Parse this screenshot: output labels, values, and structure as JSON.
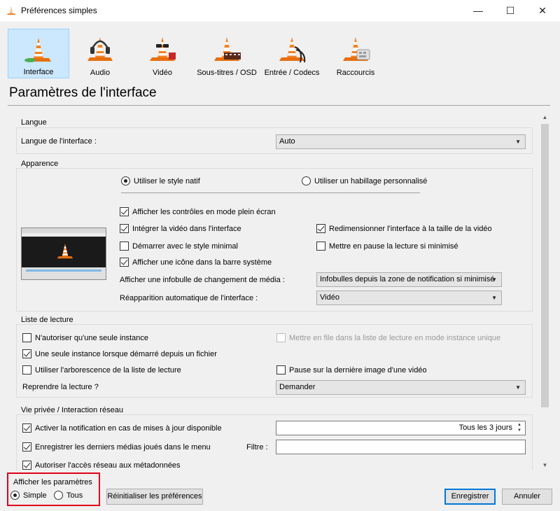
{
  "window": {
    "title": "Préférences simples",
    "minimize": "—",
    "maximize": "☐",
    "close": "✕"
  },
  "categories": [
    {
      "label": "Interface",
      "selected": true
    },
    {
      "label": "Audio",
      "selected": false
    },
    {
      "label": "Vidéo",
      "selected": false
    },
    {
      "label": "Sous-titres / OSD",
      "selected": false
    },
    {
      "label": "Entrée / Codecs",
      "selected": false
    },
    {
      "label": "Raccourcis",
      "selected": false
    }
  ],
  "page_title": "Paramètres de l'interface",
  "langue": {
    "group_title": "Langue",
    "label": "Langue de l'interface :",
    "value": "Auto"
  },
  "apparence": {
    "group_title": "Apparence",
    "style_native": "Utiliser le style natif",
    "style_custom": "Utiliser un habillage personnalisé",
    "style_selected": "native",
    "fullscreen_controls": {
      "label": "Afficher les contrôles en mode plein écran",
      "checked": true
    },
    "embed_video": {
      "label": "Intégrer la vidéo dans l'interface",
      "checked": true
    },
    "resize_interface": {
      "label": "Redimensionner l'interface à la taille de la vidéo",
      "checked": true
    },
    "minimal_style": {
      "label": "Démarrer avec le style minimal",
      "checked": false
    },
    "pause_minimized": {
      "label": "Mettre en pause la lecture si minimisé",
      "checked": false
    },
    "systray_icon": {
      "label": "Afficher une icône dans la barre système",
      "checked": true
    },
    "popup_label": "Afficher une infobulle de changement de média :",
    "popup_value": "Infobulles depuis la zone de notification si minimisé",
    "autoraise_label": "Réapparition automatique de l'interface :",
    "autoraise_value": "Vidéo"
  },
  "playlist": {
    "group_title": "Liste de lecture",
    "one_instance": {
      "label": "N'autoriser qu'une seule instance",
      "checked": false
    },
    "enqueue": {
      "label": "Mettre en file dans la liste de lecture en mode instance unique",
      "checked": false,
      "disabled": true
    },
    "one_instance_file": {
      "label": "Une seule instance lorsque démarré depuis un fichier",
      "checked": true
    },
    "tree": {
      "label": "Utiliser l'arborescence de la liste de lecture",
      "checked": false
    },
    "pause_last": {
      "label": "Pause sur la dernière image d'une vidéo",
      "checked": false
    },
    "resume_label": "Reprendre la lecture ?",
    "resume_value": "Demander"
  },
  "privacy": {
    "group_title": "Vie privée / Interaction réseau",
    "update_notify": {
      "label": "Activer la notification en cas de mises à jour disponible",
      "checked": true
    },
    "update_interval": "Tous les 3 jours",
    "recent_media": {
      "label": "Enregistrer les derniers médias joués dans le menu",
      "checked": true
    },
    "filter_label": "Filtre :",
    "filter_value": "",
    "metadata_access": {
      "label": "Autoriser l'accès réseau aux métadonnées",
      "checked": true
    }
  },
  "show_settings": {
    "title": "Afficher les paramètres",
    "simple": "Simple",
    "all": "Tous",
    "selected": "simple"
  },
  "buttons": {
    "reset": "Réinitialiser les préférences",
    "save": "Enregistrer",
    "cancel": "Annuler"
  },
  "colors": {
    "accent": "#0078d7",
    "cone_orange": "#f48020",
    "highlight_box": "#e0001b",
    "selected_category": "#cce8ff"
  },
  "icons": {
    "app": "vlc-cone-icon",
    "interface": "vlc-cone-icon",
    "audio": "headphones-cone-icon",
    "video": "glasses-cone-icon",
    "subtitles": "film-cone-icon",
    "input": "cable-cone-icon",
    "hotkeys": "keyboard-cone-icon"
  }
}
